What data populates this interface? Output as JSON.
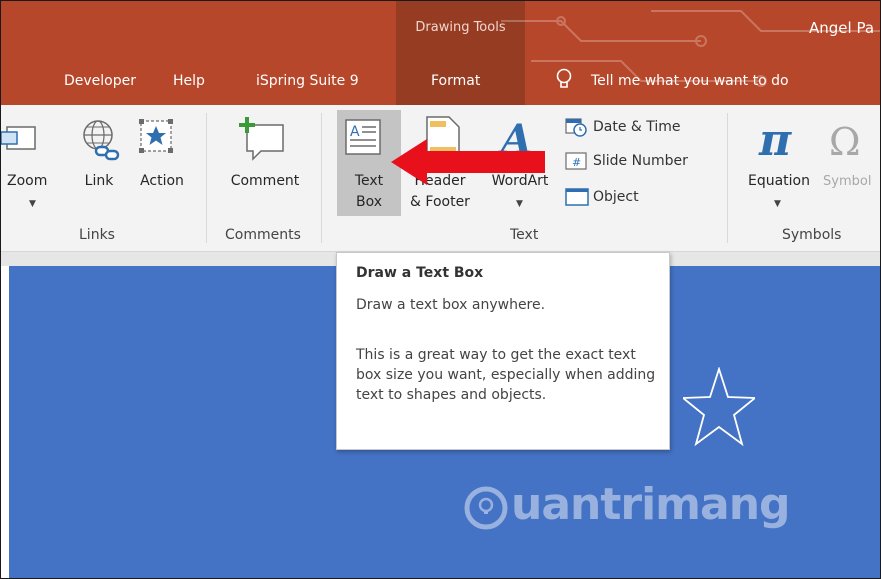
{
  "titlebar": {
    "context_title": "Drawing Tools",
    "user_name": "Angel Pa"
  },
  "tabs": [
    {
      "label": "Developer"
    },
    {
      "label": "Help"
    },
    {
      "label": "iSpring Suite 9"
    },
    {
      "label": "Format"
    },
    {
      "label": "Tell me what you want to do"
    }
  ],
  "ribbon": {
    "links": {
      "zoom_label": "Zoom",
      "link_label": "Link",
      "action_label": "Action",
      "group_label": "Links"
    },
    "comments": {
      "comment_label": "Comment",
      "group_label": "Comments"
    },
    "text": {
      "textbox_line1": "Text",
      "textbox_line2": "Box",
      "header_line1": "Header",
      "header_line2": "& Footer",
      "wordart_label": "WordArt",
      "date_time": "Date & Time",
      "slide_number": "Slide Number",
      "object": "Object",
      "group_label": "Text"
    },
    "symbols": {
      "equation_label": "Equation",
      "symbol_label": "Symbol",
      "group_label": "Symbols"
    }
  },
  "tooltip": {
    "title": "Draw a Text Box",
    "description": "Draw a text box anywhere.",
    "body": "This is a great way to get the exact text box size you want, especially when adding text to shapes and objects."
  },
  "watermark": {
    "text": "uantrimang"
  },
  "colors": {
    "title_bar": "#b7472a",
    "context_band": "#953c22",
    "slide_background": "#4472c4",
    "arrow": "#e8111b"
  }
}
